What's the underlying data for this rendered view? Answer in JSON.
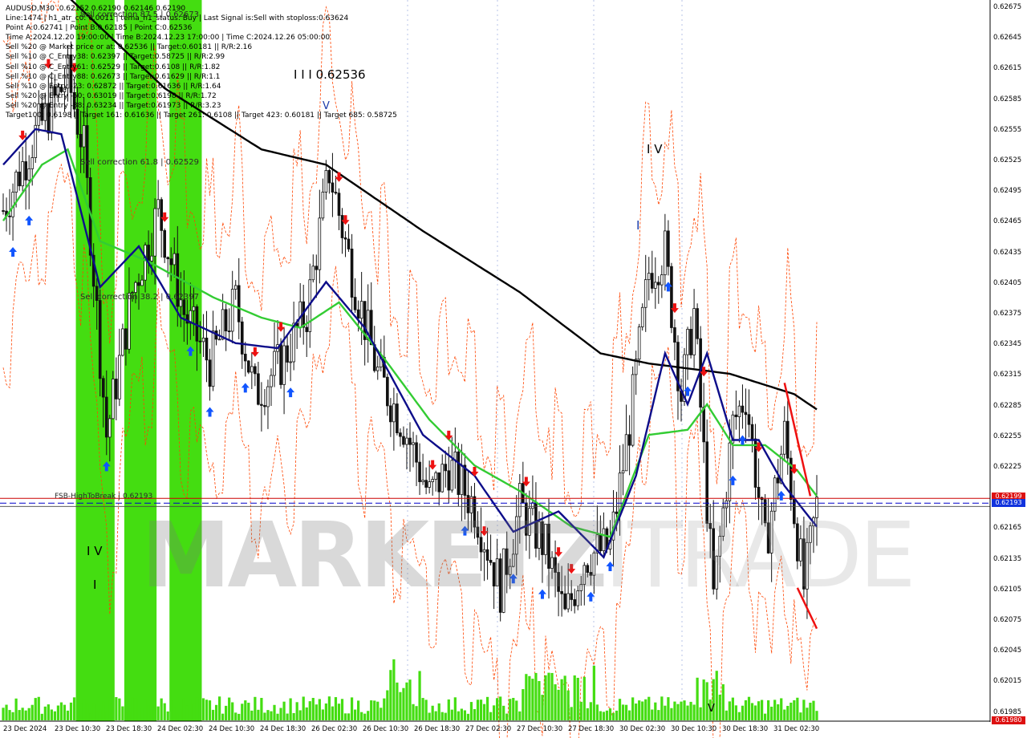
{
  "info": {
    "lines": [
      "AUDUSD,M30  0.62152 0.62190 0.62146 0.62190",
      "Line:1474 | h1_atr_c0: 0.0011 | tema_h1_status: Buy | Last Signal is:Sell with stoploss:0.63624",
      "Point A:0.62741 | Point B:0.62185 | Point C:0.62536",
      "Time A:2024.12.20 19:00:00 | Time B:2024.12.23 17:00:00 | Time C:2024.12.26 05:00:00",
      "Sell %20 @ Market price or at: 0.62536 || Target:0.60181 || R/R:2.16",
      "Sell %10 @ C_Entry38: 0.62397 || Target:0.58725 || R/R:2.99",
      "Sell %10 @ C_Entry61: 0.62529 || Target:0.6108 || R/R:1.82",
      "Sell %10 @ C_Entry88: 0.62673 || Target:0.61629 || R/R:1.1",
      "Sell %10 @ Entry -23: 0.62872 || Target:0.61636 || R/R:1.64",
      "Sell %20 @ Entry -50: 0.63019 || Target:0.6198 || R/R:1.72",
      "Sell %20 @ Entry -88: 0.63234 || Target:0.61973 || R/R:3.23",
      "Target100: 0.6198 || Target 161: 0.61636 || Target 261: 0.6108 || Target 423: 0.60181 || Target 685: 0.58725"
    ]
  },
  "labels": {
    "wave_c": "I I I 0.62536",
    "wave_iv_top": "I V",
    "wave_v_top": "V",
    "wave_i": "I",
    "wave_iv_bottom": "I V",
    "wave_i_bottom": "I",
    "wave_v_bottom": "V",
    "fib_sell_61": "Sell correction 61.8 | 0.62529",
    "fib_sell_38": "Sell correction 38.2 | 0.62397",
    "fib_sell_87": "Sell correction 87.5 | 0.62673",
    "fsb": "FSB-HighToBreak | 0.62193"
  },
  "watermark": {
    "bold": "MARKETZ",
    "light": "ITRADE"
  },
  "price_axis": {
    "ticks": [
      "0.62675",
      "0.62645",
      "0.62615",
      "0.62585",
      "0.62555",
      "0.62525",
      "0.62495",
      "0.62465",
      "0.62435",
      "0.62405",
      "0.62375",
      "0.62345",
      "0.62315",
      "0.62285",
      "0.62255",
      "0.62225",
      "0.62195",
      "0.62165",
      "0.62135",
      "0.62105",
      "0.62075",
      "0.62045",
      "0.62015",
      "0.61985"
    ],
    "tag_fsb": "0.62199",
    "tag_current": "0.62193",
    "tag_bottom": "0.61980",
    "tag_hidden": "0.62190"
  },
  "time_axis": {
    "ticks": [
      "23 Dec 2024",
      "23 Dec 10:30",
      "23 Dec 18:30",
      "24 Dec 02:30",
      "24 Dec 10:30",
      "24 Dec 18:30",
      "26 Dec 02:30",
      "26 Dec 10:30",
      "26 Dec 18:30",
      "27 Dec 02:30",
      "27 Dec 10:30",
      "27 Dec 18:30",
      "30 Dec 02:30",
      "30 Dec 10:30",
      "30 Dec 18:30",
      "31 Dec 02:30"
    ]
  },
  "colors": {
    "background": "#ffffff",
    "candle": "#111111",
    "ma_slow": "#000000",
    "ma_blue": "#0d0d8a",
    "ma_green": "#33cc33",
    "bands": "#ff4400",
    "green_zone": "#44dd11",
    "fsb_line": "#cc0000",
    "current_line": "#0000cc",
    "volume": "#44dd11",
    "buy_arrow": "#1155ff",
    "sell_arrow": "#ee1111",
    "wedge": "#ee1111"
  },
  "chart_data": {
    "type": "candlestick",
    "symbol": "AUDUSD",
    "timeframe": "M30",
    "ohlc_last": {
      "open": 0.62152,
      "high": 0.6219,
      "low": 0.62146,
      "close": 0.6219
    },
    "ylim": [
      0.6198,
      0.62685
    ],
    "levels": {
      "fsb_high_to_break": 0.62193,
      "current": 0.62193,
      "sell_c38": 0.62397,
      "sell_c61": 0.62529,
      "sell_c88": 0.62673
    },
    "close_path": [
      {
        "bar": 0,
        "close": 0.6248
      },
      {
        "bar": 10,
        "close": 0.62555
      },
      {
        "bar": 20,
        "close": 0.6261
      },
      {
        "bar": 25,
        "close": 0.6254
      },
      {
        "bar": 32,
        "close": 0.6226
      },
      {
        "bar": 40,
        "close": 0.624
      },
      {
        "bar": 48,
        "close": 0.6248
      },
      {
        "bar": 56,
        "close": 0.6238
      },
      {
        "bar": 64,
        "close": 0.6233
      },
      {
        "bar": 72,
        "close": 0.6239
      },
      {
        "bar": 78,
        "close": 0.623
      },
      {
        "bar": 86,
        "close": 0.6233
      },
      {
        "bar": 94,
        "close": 0.6238
      },
      {
        "bar": 101,
        "close": 0.6252
      },
      {
        "bar": 108,
        "close": 0.6242
      },
      {
        "bar": 116,
        "close": 0.6232
      },
      {
        "bar": 124,
        "close": 0.6227
      },
      {
        "bar": 132,
        "close": 0.622
      },
      {
        "bar": 138,
        "close": 0.6223
      },
      {
        "bar": 146,
        "close": 0.6219
      },
      {
        "bar": 154,
        "close": 0.6211
      },
      {
        "bar": 160,
        "close": 0.6219
      },
      {
        "bar": 168,
        "close": 0.6215
      },
      {
        "bar": 174,
        "close": 0.6208
      },
      {
        "bar": 180,
        "close": 0.6214
      },
      {
        "bar": 188,
        "close": 0.6215
      },
      {
        "bar": 194,
        "close": 0.6227
      },
      {
        "bar": 200,
        "close": 0.6242
      },
      {
        "bar": 205,
        "close": 0.6244
      },
      {
        "bar": 210,
        "close": 0.623
      },
      {
        "bar": 214,
        "close": 0.6238
      },
      {
        "bar": 220,
        "close": 0.621
      },
      {
        "bar": 226,
        "close": 0.6227
      },
      {
        "bar": 230,
        "close": 0.623
      },
      {
        "bar": 236,
        "close": 0.6215
      },
      {
        "bar": 242,
        "close": 0.6226
      },
      {
        "bar": 248,
        "close": 0.6211
      },
      {
        "bar": 252,
        "close": 0.6219
      }
    ],
    "ma_slow": [
      {
        "bar": 0,
        "v": 0.6272
      },
      {
        "bar": 20,
        "v": 0.6269
      },
      {
        "bar": 50,
        "v": 0.626
      },
      {
        "bar": 80,
        "v": 0.6254
      },
      {
        "bar": 100,
        "v": 0.62525
      },
      {
        "bar": 130,
        "v": 0.6246
      },
      {
        "bar": 160,
        "v": 0.624
      },
      {
        "bar": 185,
        "v": 0.6234
      },
      {
        "bar": 200,
        "v": 0.6233
      },
      {
        "bar": 225,
        "v": 0.6232
      },
      {
        "bar": 245,
        "v": 0.623
      },
      {
        "bar": 252,
        "v": 0.62285
      }
    ],
    "ma_blue": [
      {
        "bar": 0,
        "v": 0.62525
      },
      {
        "bar": 10,
        "v": 0.6256
      },
      {
        "bar": 18,
        "v": 0.62555
      },
      {
        "bar": 30,
        "v": 0.62405
      },
      {
        "bar": 42,
        "v": 0.62445
      },
      {
        "bar": 55,
        "v": 0.62375
      },
      {
        "bar": 72,
        "v": 0.6235
      },
      {
        "bar": 85,
        "v": 0.62345
      },
      {
        "bar": 100,
        "v": 0.6241
      },
      {
        "bar": 112,
        "v": 0.62365
      },
      {
        "bar": 130,
        "v": 0.6226
      },
      {
        "bar": 146,
        "v": 0.6222
      },
      {
        "bar": 158,
        "v": 0.62165
      },
      {
        "bar": 172,
        "v": 0.62185
      },
      {
        "bar": 186,
        "v": 0.6214
      },
      {
        "bar": 196,
        "v": 0.6222
      },
      {
        "bar": 205,
        "v": 0.6234
      },
      {
        "bar": 212,
        "v": 0.6229
      },
      {
        "bar": 218,
        "v": 0.6234
      },
      {
        "bar": 226,
        "v": 0.62255
      },
      {
        "bar": 234,
        "v": 0.62255
      },
      {
        "bar": 242,
        "v": 0.6221
      },
      {
        "bar": 252,
        "v": 0.6217
      }
    ],
    "ma_green": [
      {
        "bar": 0,
        "v": 0.6247
      },
      {
        "bar": 12,
        "v": 0.62525
      },
      {
        "bar": 20,
        "v": 0.6254
      },
      {
        "bar": 30,
        "v": 0.6245
      },
      {
        "bar": 45,
        "v": 0.6243
      },
      {
        "bar": 65,
        "v": 0.62395
      },
      {
        "bar": 80,
        "v": 0.62375
      },
      {
        "bar": 92,
        "v": 0.62365
      },
      {
        "bar": 104,
        "v": 0.6239
      },
      {
        "bar": 118,
        "v": 0.62335
      },
      {
        "bar": 132,
        "v": 0.62275
      },
      {
        "bar": 146,
        "v": 0.6223
      },
      {
        "bar": 160,
        "v": 0.62205
      },
      {
        "bar": 176,
        "v": 0.6217
      },
      {
        "bar": 188,
        "v": 0.6216
      },
      {
        "bar": 200,
        "v": 0.6226
      },
      {
        "bar": 212,
        "v": 0.62265
      },
      {
        "bar": 218,
        "v": 0.6229
      },
      {
        "bar": 226,
        "v": 0.6225
      },
      {
        "bar": 236,
        "v": 0.6225
      },
      {
        "bar": 246,
        "v": 0.62225
      },
      {
        "bar": 252,
        "v": 0.622
      }
    ],
    "green_zones": [
      {
        "from_bar": 23,
        "to_bar": 35
      },
      {
        "from_bar": 38,
        "to_bar": 48
      },
      {
        "from_bar": 52,
        "to_bar": 62
      }
    ],
    "sell_arrows_bars": [
      6,
      14,
      22,
      50,
      78,
      86,
      104,
      106,
      133,
      138,
      146,
      149,
      162,
      172,
      176,
      208,
      217,
      234,
      245
    ],
    "buy_arrows_bars": [
      3,
      8,
      32,
      58,
      64,
      75,
      89,
      143,
      158,
      167,
      182,
      188,
      206,
      212,
      226,
      229,
      241
    ],
    "wedge": {
      "upper": [
        {
          "bar": 242,
          "v": 0.62311
        },
        {
          "bar": 250,
          "v": 0.622
        }
      ],
      "lower": [
        {
          "bar": 246,
          "v": 0.6211
        },
        {
          "bar": 252,
          "v": 0.6207
        }
      ]
    }
  }
}
